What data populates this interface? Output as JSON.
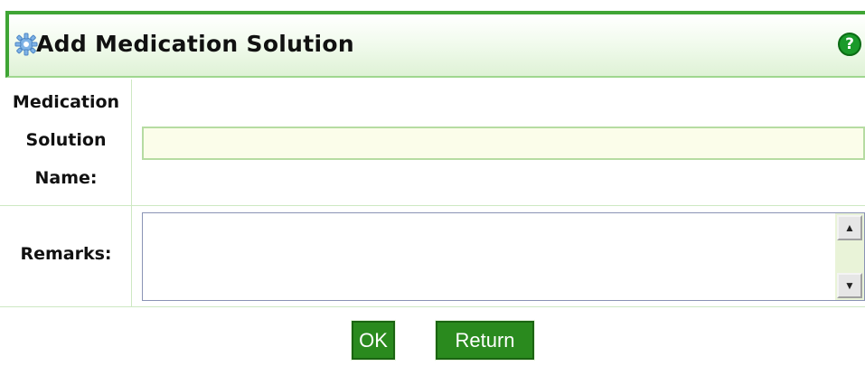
{
  "dialog": {
    "title": "Add Medication Solution",
    "help_icon": "?"
  },
  "fields": {
    "name": {
      "label_lines": [
        "Medication",
        "Solution",
        "Name:"
      ],
      "value": "",
      "placeholder": ""
    },
    "remarks": {
      "label": "Remarks:",
      "value": ""
    }
  },
  "scrollbar": {
    "up_glyph": "▲",
    "down_glyph": "▼"
  },
  "actions": {
    "ok_label": "OK",
    "return_label": "Return"
  },
  "icons": {
    "title": "gear-icon",
    "help": "help-icon"
  },
  "colors": {
    "accent": "#3fa535",
    "button": "#2a8a1e",
    "header_gradient_end": "#dff2d6",
    "input_bg": "#fbfdea"
  }
}
